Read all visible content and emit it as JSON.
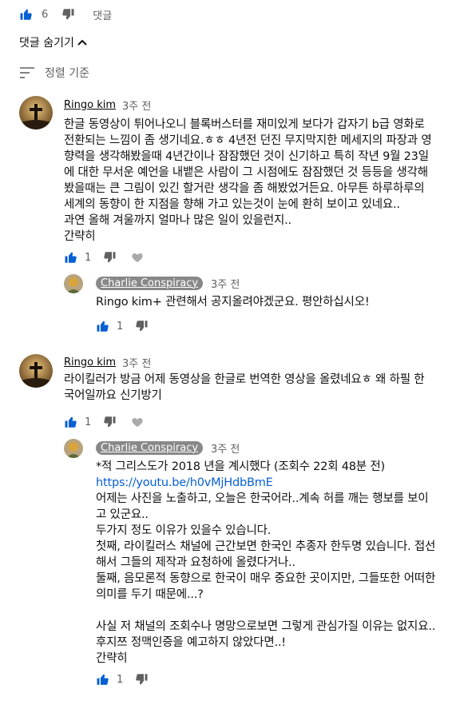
{
  "top_actions": {
    "like_count": "6",
    "reply_label": "댓글"
  },
  "hide_replies": {
    "label": "댓글 숨기기"
  },
  "sort": {
    "label": "정렬 기준"
  },
  "comments": [
    {
      "author": "Ringo kim",
      "time": "3주 전",
      "lines": [
        "한글 동영상이 튀어나오니 블록버스터를 재미있게 보다가 갑자기 b급 영화로",
        "전환되는 느낌이 좀 생기네요.ㅎㅎ  4년전 던진 무지막지한 메세지의 파장과 영",
        "향력을 생각해봤을때 4년간이나 잠잠했던 것이 신기하고  특히 작년 9월 23일",
        "에 대한 무서운 예언을 내뱉은 사람이 그 시점에도 잠잠했던 것 등등을 생각해",
        "봤을때는 큰 그림이 있긴 할거란 생각을 좀 해봤었거든요. 아무튼  하루하루의",
        "세계의 동향이 한 지점을 향해 가고 있는것이 눈에 환히 보이고 있네요..",
        "과연 올해 겨울까지 얼마나 많은 일이 있을런지..",
        "간략히"
      ],
      "like_count": "1",
      "reply": {
        "author": "Charlie Conspiracy",
        "time": "3주 전",
        "lines": [
          "Ringo kim+ 관련해서 공지올려야겠군요. 평안하십시오!"
        ],
        "like_count": "1"
      }
    },
    {
      "author": "Ringo kim",
      "time": "3주 전",
      "lines": [
        "라이킬러가 방금 어제 동영상을 한글로 번역한 영상을 올렸네요ㅎ    왜 하필 한",
        "국어일까요 신기방기"
      ],
      "like_count": "1",
      "reply": {
        "author": "Charlie Conspiracy",
        "time": "3주 전",
        "lines": [
          "*적 그리스도가 2018 년을 계시했다 (조회수 22회 48분 전)",
          "https://youtu.be/h0vMjHdbBmE",
          "어제는 사진을 노출하고, 오늘은 한국어라..계속 허를 깨는 행보를 보이",
          "고 있군요..",
          "두가지 정도 이유가 있을수 있습니다.",
          "첫째, 라이킬러스 채널에 근간보면 한국인 추종자 한두명 있습니다. 접선",
          "해서 그들의 제작과 요청하에 올렸다거나..",
          "둘째, 음모론적 동향으로 한국이 매우 중요한 곳이지만, 그들또한 어떠한",
          "의미를 두기 때문에...?",
          "",
          "사실 저 채널의 조회수나 명망으로보면 그렇게 관심가질 이유는 없지요..",
          "후지쯔 정맥인증을 예고하지 않았다면..!",
          "간략히"
        ],
        "like_count": "1"
      }
    }
  ],
  "colors": {
    "like_blue": "#065fd4",
    "link_blue": "#065fd4",
    "muted": "#606060",
    "pill_bg": "#888888"
  }
}
